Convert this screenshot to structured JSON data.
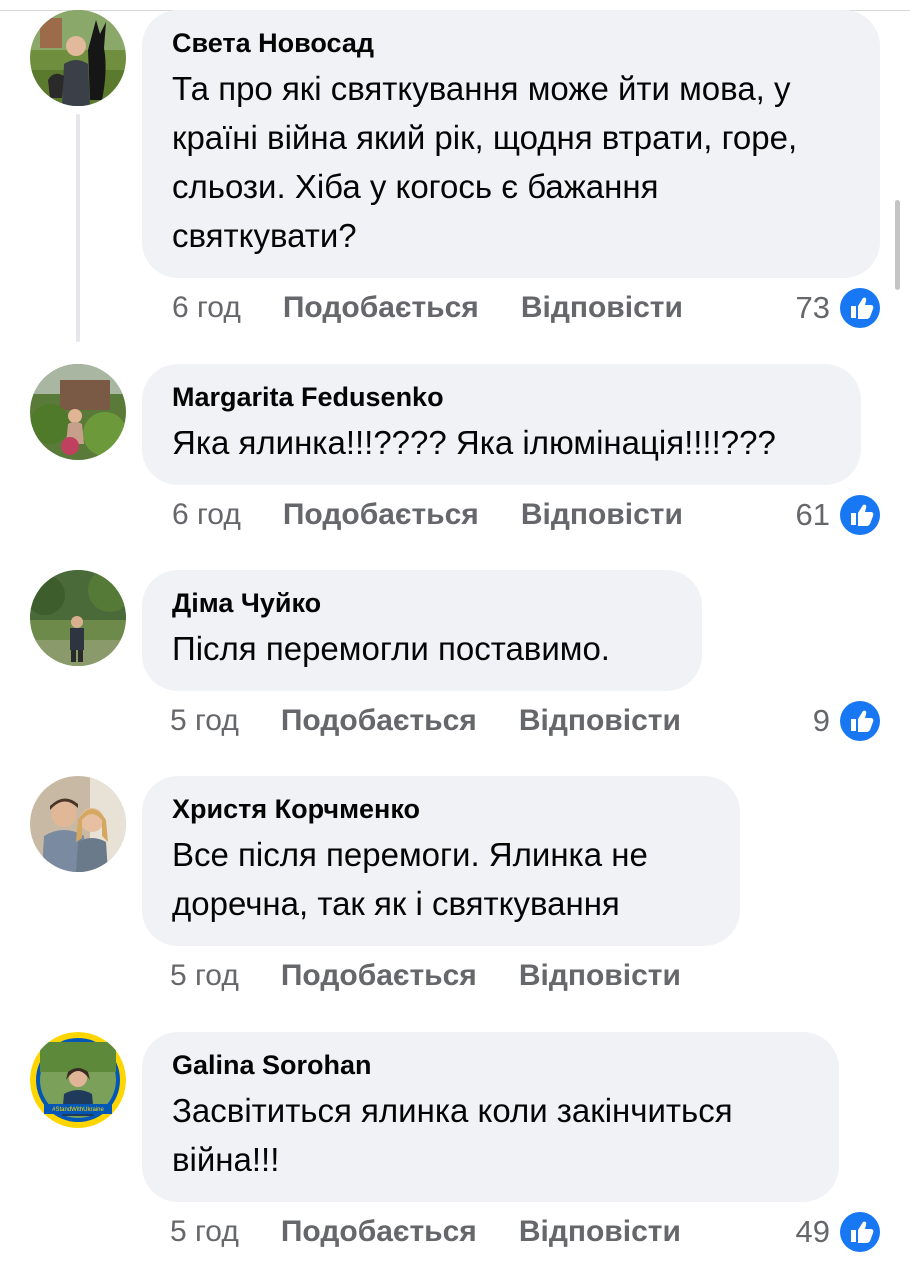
{
  "ui": {
    "like_color": "#1877f2",
    "bubble_color": "#f0f2f5",
    "muted_text_color": "#65676b"
  },
  "comments": [
    {
      "author": "Света Новосад",
      "text": "Та про які святкування може йти мова, у країні війна який рік, щодня втрати, горе, сльози. Хіба у когось є бажання святкувати?",
      "time": "6 год",
      "like_label": "Подобається",
      "reply_label": "Відповісти",
      "reactions": "73",
      "reaction_icon": "like-icon"
    },
    {
      "author": "Margarita Fedusenko",
      "text": "Яка ялинка!!!???? Яка ілюмінація!!!!???",
      "time": "6 год",
      "like_label": "Подобається",
      "reply_label": "Відповісти",
      "reactions": "61",
      "reaction_icon": "like-icon"
    },
    {
      "author": "Діма Чуйко",
      "text": "Після перемогли поставимо.",
      "time": "5 год",
      "like_label": "Подобається",
      "reply_label": "Відповісти",
      "reactions": "9",
      "reaction_icon": "like-icon"
    },
    {
      "author": "Христя Корчменко",
      "text": "Все після перемоги. Ялинка не доречна, так як і святкування",
      "time": "5 год",
      "like_label": "Подобається",
      "reply_label": "Відповісти"
    },
    {
      "author": "Galina Sorohan",
      "avatar_badge": "#StandWithUkraine",
      "text": "Засвітиться ялинка коли закінчиться війна!!!",
      "time": "5 год",
      "like_label": "Подобається",
      "reply_label": "Відповісти",
      "reactions": "49",
      "reaction_icon": "like-icon"
    }
  ]
}
